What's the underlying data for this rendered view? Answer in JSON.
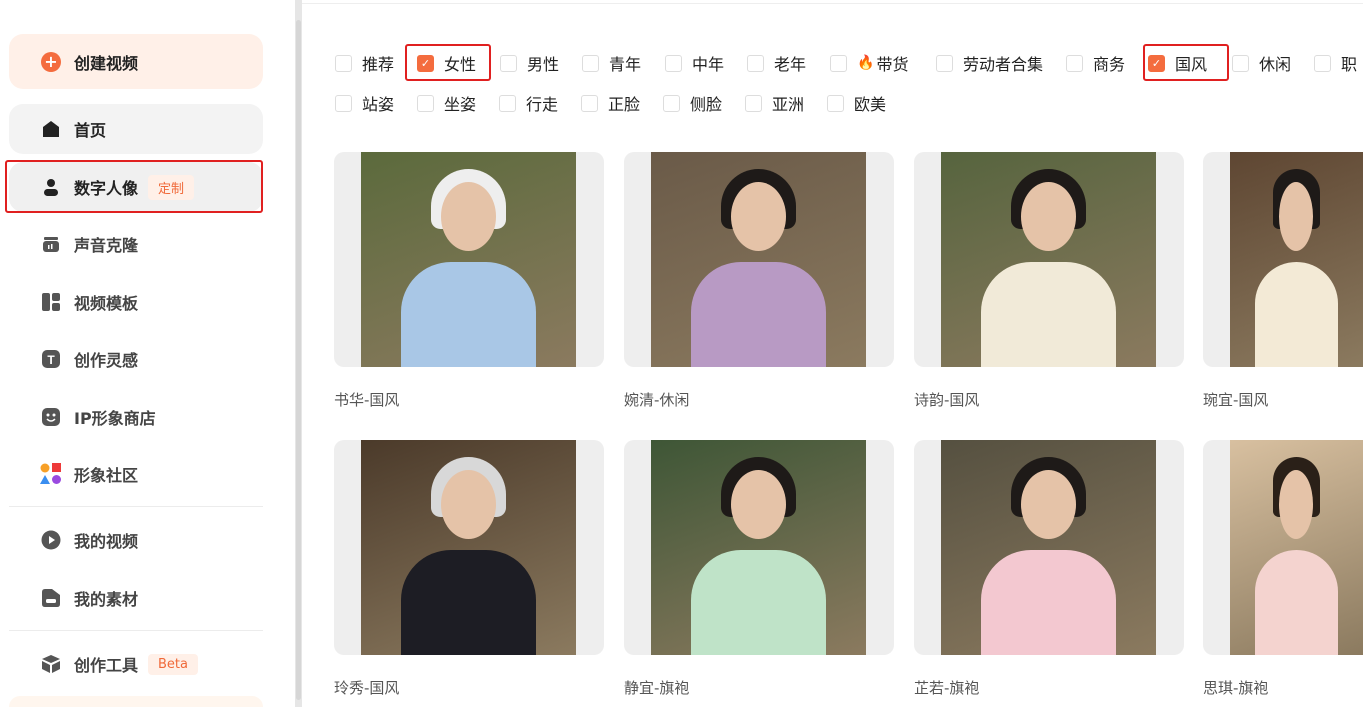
{
  "sidebar": {
    "create": "创建视频",
    "items": [
      {
        "label": "首页",
        "icon": "home-icon"
      },
      {
        "label": "数字人像",
        "icon": "person-icon",
        "badge": "定制"
      },
      {
        "label": "声音克隆",
        "icon": "voice-icon"
      },
      {
        "label": "视频模板",
        "icon": "template-icon"
      },
      {
        "label": "创作灵感",
        "icon": "inspiration-icon"
      },
      {
        "label": "IP形象商店",
        "icon": "store-icon"
      },
      {
        "label": "形象社区",
        "icon": "community-icon"
      },
      {
        "label": "我的视频",
        "icon": "play-icon"
      },
      {
        "label": "我的素材",
        "icon": "folder-icon"
      },
      {
        "label": "创作工具",
        "icon": "cube-icon",
        "badge": "Beta"
      }
    ]
  },
  "filters": {
    "row1": [
      {
        "label": "推荐",
        "checked": false
      },
      {
        "label": "女性",
        "checked": true
      },
      {
        "label": "男性",
        "checked": false
      },
      {
        "label": "青年",
        "checked": false
      },
      {
        "label": "中年",
        "checked": false
      },
      {
        "label": "老年",
        "checked": false
      },
      {
        "label": "带货",
        "checked": false,
        "icon": "fire-icon"
      },
      {
        "label": "劳动者合集",
        "checked": false
      },
      {
        "label": "商务",
        "checked": false
      },
      {
        "label": "国风",
        "checked": true
      },
      {
        "label": "休闲",
        "checked": false
      },
      {
        "label": "职",
        "checked": false
      }
    ],
    "row2": [
      {
        "label": "站姿"
      },
      {
        "label": "坐姿"
      },
      {
        "label": "行走"
      },
      {
        "label": "正脸"
      },
      {
        "label": "侧脸"
      },
      {
        "label": "亚洲"
      },
      {
        "label": "欧美"
      }
    ]
  },
  "cards": [
    {
      "name": "书华-国风"
    },
    {
      "name": "婉清-休闲"
    },
    {
      "name": "诗韵-国风"
    },
    {
      "name": "琬宜-国风"
    },
    {
      "name": "玲秀-国风"
    },
    {
      "name": "静宜-旗袍"
    },
    {
      "name": "芷若-旗袍"
    },
    {
      "name": "思琪-旗袍"
    }
  ],
  "colors": {
    "accent": "#f46c3e",
    "highlight": "#e02020"
  }
}
